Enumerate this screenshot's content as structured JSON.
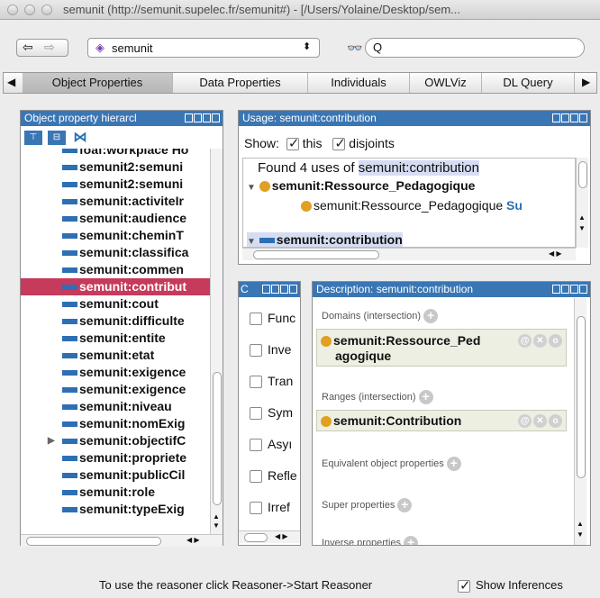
{
  "window": {
    "title": "semunit (http://semunit.supelec.fr/semunit#) - [/Users/Yolaine/Desktop/sem..."
  },
  "toolbar": {
    "ontology_combo": "semunit",
    "search_placeholder": "Q"
  },
  "tabs": [
    {
      "label": "Object Properties",
      "active": true
    },
    {
      "label": "Data Properties",
      "active": false
    },
    {
      "label": "Individuals",
      "active": false
    },
    {
      "label": "OWLViz",
      "active": false
    },
    {
      "label": "DL Query",
      "active": false
    }
  ],
  "hierarchy": {
    "title": "Object property hierarcl",
    "items": [
      {
        "label": "foaf:workplace Ho",
        "selected": false
      },
      {
        "label": "semunit2:semuni",
        "selected": false
      },
      {
        "label": "semunit2:semuni",
        "selected": false
      },
      {
        "label": "semunit:activiteIr",
        "selected": false
      },
      {
        "label": "semunit:audience",
        "selected": false
      },
      {
        "label": "semunit:cheminT",
        "selected": false
      },
      {
        "label": "semunit:classifica",
        "selected": false
      },
      {
        "label": "semunit:commen",
        "selected": false
      },
      {
        "label": "semunit:contribut",
        "selected": true
      },
      {
        "label": "semunit:cout",
        "selected": false
      },
      {
        "label": "semunit:difficulte",
        "selected": false
      },
      {
        "label": "semunit:entite",
        "selected": false
      },
      {
        "label": "semunit:etat",
        "selected": false
      },
      {
        "label": "semunit:exigence",
        "selected": false
      },
      {
        "label": "semunit:exigence",
        "selected": false
      },
      {
        "label": "semunit:niveau",
        "selected": false
      },
      {
        "label": "semunit:nomExig",
        "selected": false
      },
      {
        "label": "semunit:objectifC",
        "selected": false,
        "expandable": true
      },
      {
        "label": "semunit:propriete",
        "selected": false
      },
      {
        "label": "semunit:publicCil",
        "selected": false
      },
      {
        "label": "semunit:role",
        "selected": false
      },
      {
        "label": "semunit:typeExig",
        "selected": false
      }
    ]
  },
  "usage": {
    "title": "Usage: semunit:contribution",
    "show_label": "Show:",
    "this_label": "this",
    "disjoints_label": "disjoints",
    "found_prefix": "Found 4 uses of ",
    "found_entity": "semunit:contribution",
    "tree_parent": "semunit:Ressource_Pedagogique",
    "tree_child": "semunit:Ressource_Pedagogique",
    "tree_child_suffix": "Su",
    "tree_next": "semunit:contribution"
  },
  "characteristics": {
    "title": "C",
    "items": [
      "Func",
      "Inve",
      "Tran",
      "Sym",
      "Asyı",
      "Refle",
      "Irref"
    ]
  },
  "description": {
    "title": "Description: semunit:contribution",
    "domains_label": "Domains (intersection)",
    "domain_value_line1": "semunit:Ressource_Ped",
    "domain_value_line2": "agogique",
    "ranges_label": "Ranges (intersection)",
    "range_value": "semunit:Contribution",
    "equivalent_label": "Equivalent object properties",
    "super_label": "Super properties",
    "inverse_label": "Inverse properties"
  },
  "status": {
    "reasoner_text": "To use the reasoner click Reasoner->Start Reasoner",
    "show_inferences_label": "Show Inferences"
  }
}
